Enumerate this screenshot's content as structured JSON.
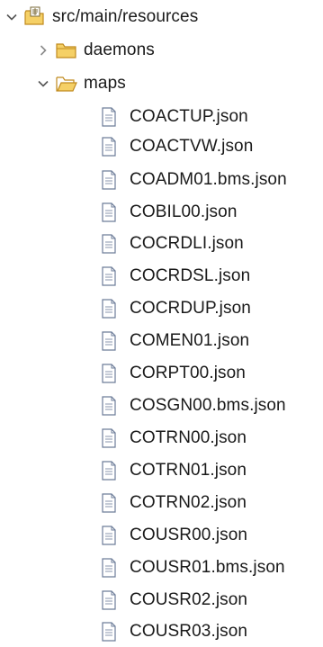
{
  "tree": {
    "root": {
      "label": "src/main/resources",
      "expanded": true,
      "icon": "source-folder-icon",
      "children": [
        {
          "label": "daemons",
          "expanded": false,
          "icon": "folder-icon"
        },
        {
          "label": "maps",
          "expanded": true,
          "icon": "folder-open-icon",
          "files": [
            "COACTUP.json",
            "COACTVW.json",
            "COADM01.bms.json",
            "COBIL00.json",
            "COCRDLI.json",
            "COCRDSL.json",
            "COCRDUP.json",
            "COMEN01.json",
            "CORPT00.json",
            "COSGN00.bms.json",
            "COTRN00.json",
            "COTRN01.json",
            "COTRN02.json",
            "COUSR00.json",
            "COUSR01.bms.json",
            "COUSR02.json",
            "COUSR03.json"
          ]
        }
      ]
    }
  },
  "colors": {
    "folder_fill": "#f5d066",
    "folder_stroke": "#c08a1e",
    "file_stroke": "#6d7d99",
    "twisty": "#555555",
    "text": "#1a1a1a"
  }
}
